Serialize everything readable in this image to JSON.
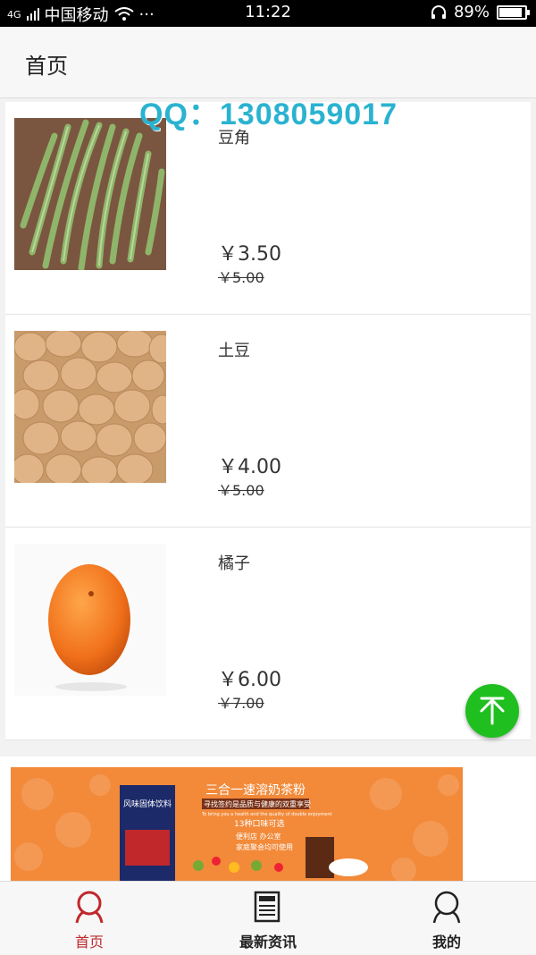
{
  "status_bar": {
    "carrier": "中国移动",
    "network": "4G",
    "time": "11:22",
    "battery": "89%",
    "battery_level": 0.89,
    "more": "···"
  },
  "header": {
    "title": "首页"
  },
  "watermark": "QQ：1308059017",
  "products": [
    {
      "name": "豆角",
      "price": "￥3.50",
      "original_price": "￥5.00",
      "image": "green-beans"
    },
    {
      "name": "土豆",
      "price": "￥4.00",
      "original_price": "￥5.00",
      "image": "potatoes"
    },
    {
      "name": "橘子",
      "price": "￥6.00",
      "original_price": "￥7.00",
      "image": "orange"
    }
  ],
  "banner": {
    "headline": "三合一速溶奶茶粉",
    "sub1": "寻找签约是品质与健康的双重享受",
    "sub2": "To bring you a health and the quality of double enjoyment",
    "badge": "13种口味可选",
    "lines": [
      "便利店  办公室",
      "家庭聚会均可使用"
    ],
    "product_label": "风味固体饮料"
  },
  "tabbar": [
    {
      "label": "首页",
      "icon": "user-outline-icon",
      "active": true,
      "color": "#c0282c"
    },
    {
      "label": "最新资讯",
      "icon": "newspaper-icon",
      "active": false,
      "color": "#222222"
    },
    {
      "label": "我的",
      "icon": "user-outline-icon",
      "active": false,
      "color": "#222222"
    }
  ],
  "colors": {
    "accent": "#c0282c",
    "to_top": "#1fbf1f",
    "watermark": "#2ab3d0"
  }
}
